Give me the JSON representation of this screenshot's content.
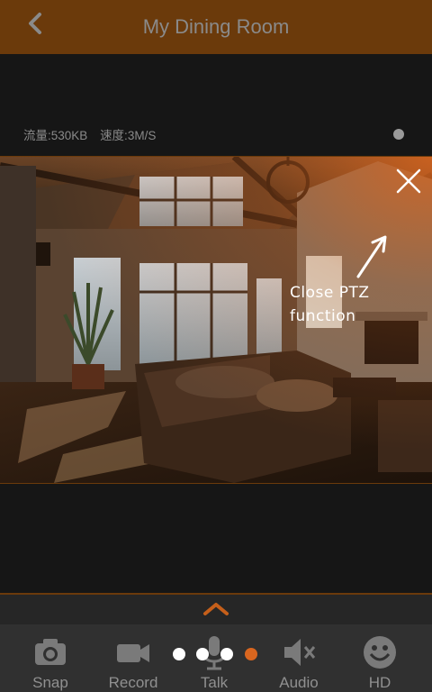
{
  "header": {
    "title": "My Dining Room",
    "back_icon": "chevron-left-icon"
  },
  "stats": {
    "traffic": "流量:530KB",
    "speed": "速度:3M/S"
  },
  "video": {
    "close_icon": "close-icon",
    "note_line1": "Close PTZ",
    "note_line2": "function"
  },
  "toolbar": {
    "expand_icon": "chevron-up-icon",
    "items": [
      {
        "label": "Snap",
        "icon": "camera-icon"
      },
      {
        "label": "Record",
        "icon": "video-camera-icon"
      },
      {
        "label": "Talk",
        "icon": "microphone-icon"
      },
      {
        "label": "Audio",
        "icon": "speaker-mute-icon"
      },
      {
        "label": "HD",
        "icon": "smiley-icon"
      }
    ]
  },
  "pager": {
    "count": 4,
    "active_index": 3
  },
  "colors": {
    "header_bg": "#6b3a0b",
    "accent": "#d9661f",
    "toolbar_bg": "#303030",
    "muted_text": "#8a8a8a"
  }
}
